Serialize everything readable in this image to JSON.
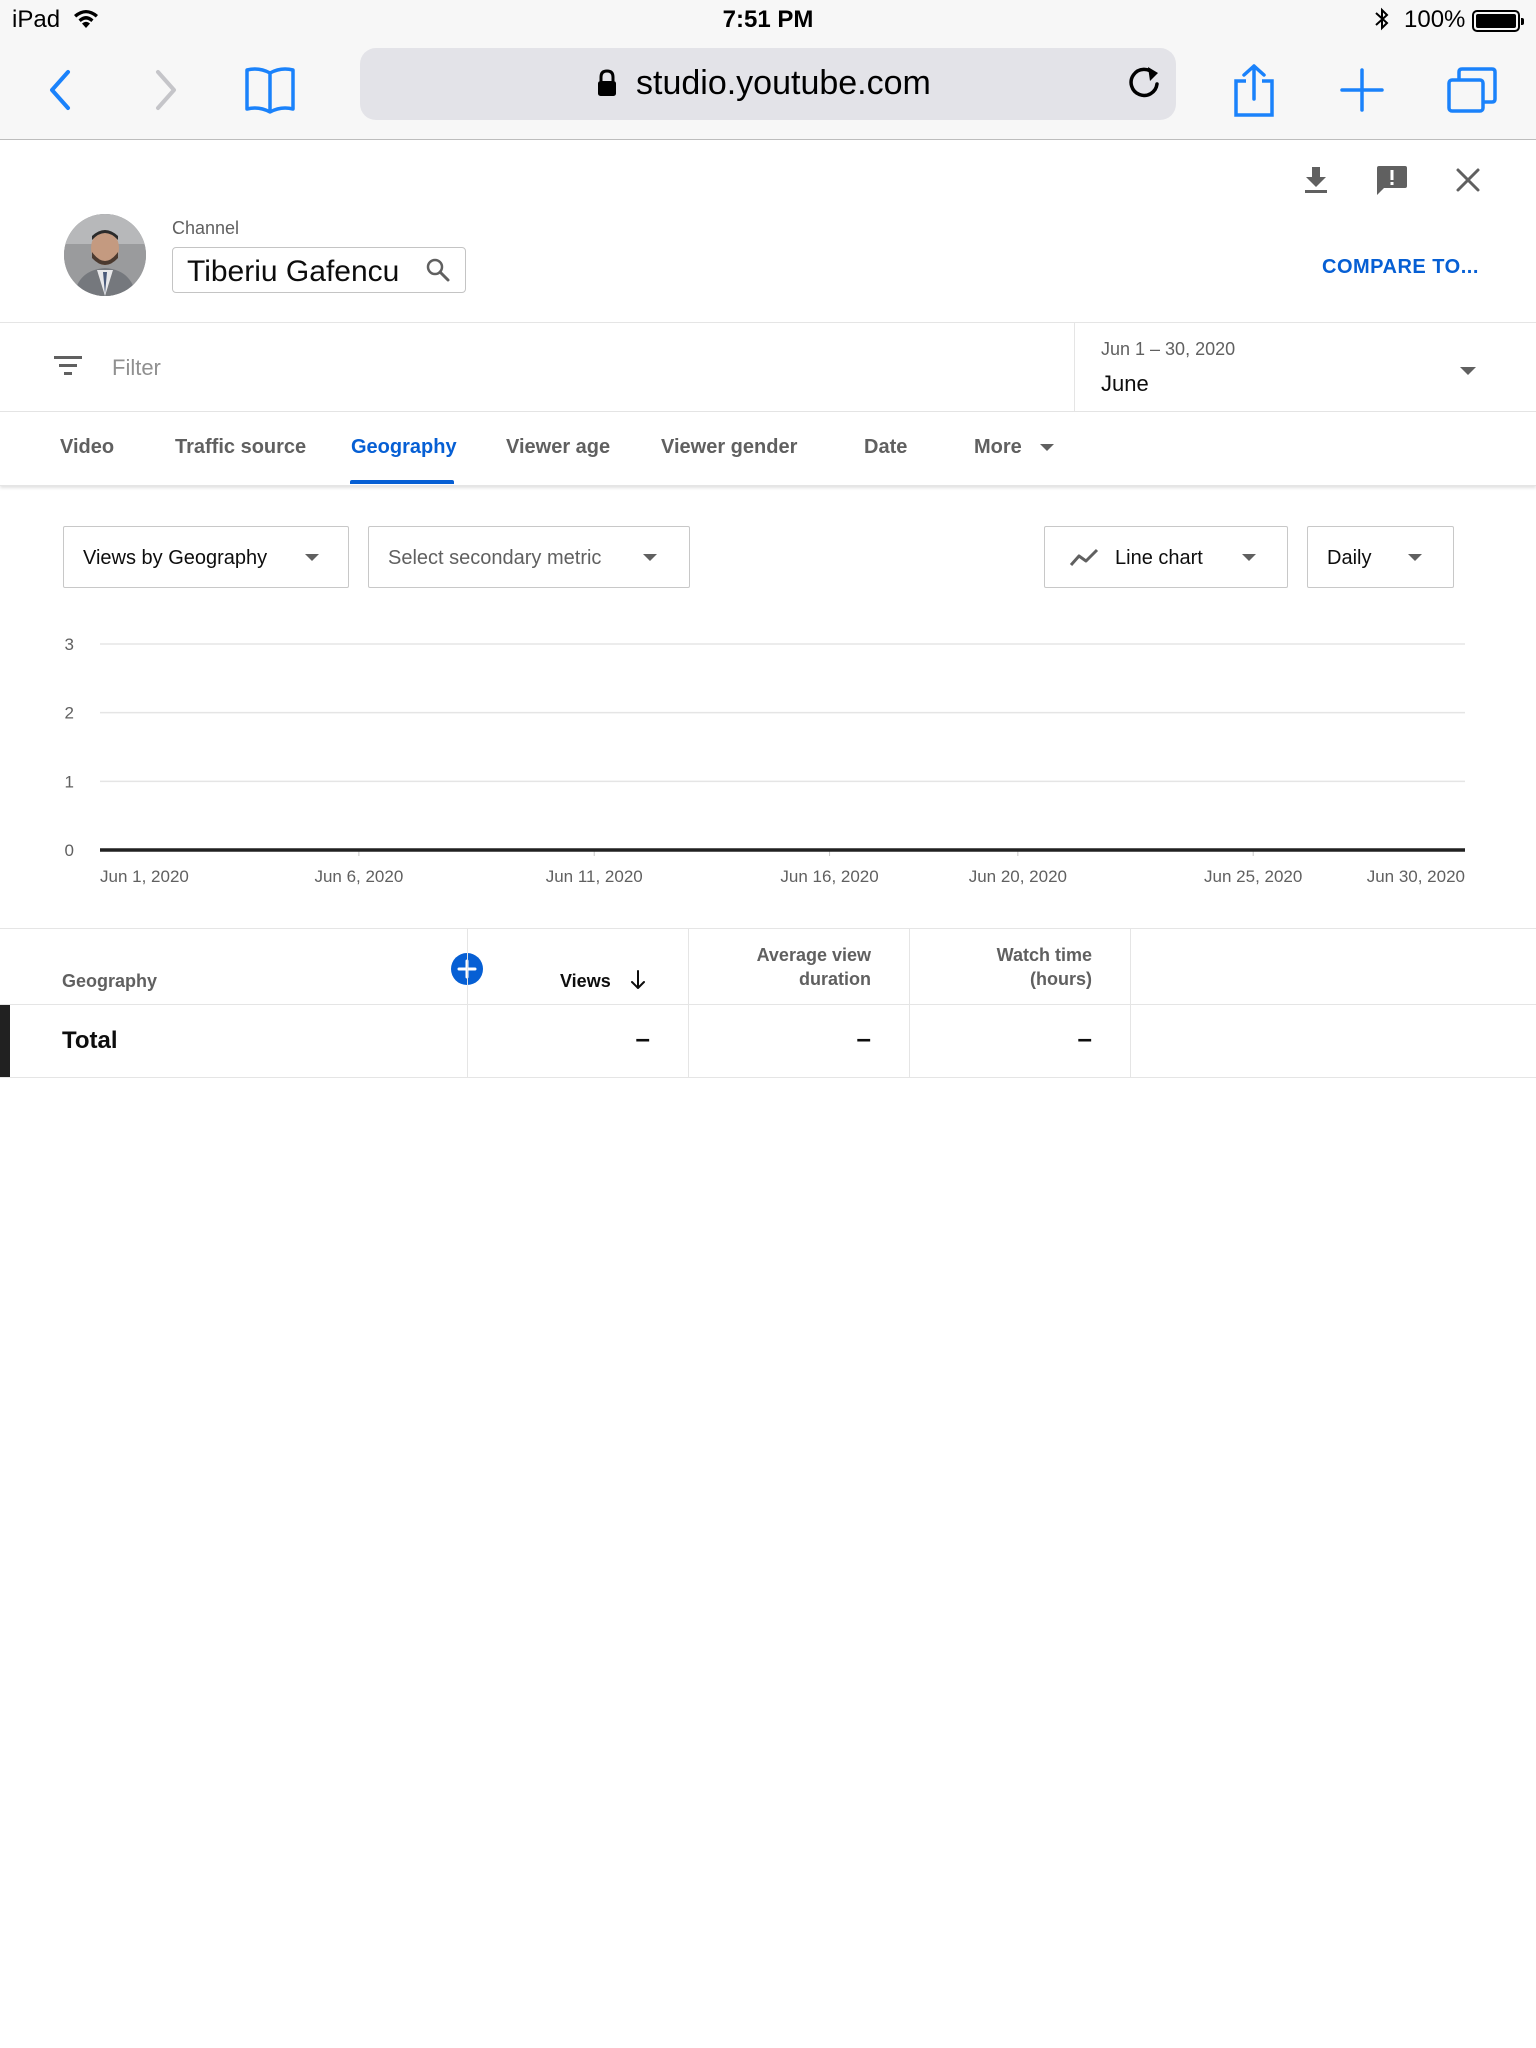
{
  "status_bar": {
    "device": "iPad",
    "time": "7:51 PM",
    "battery": "100%"
  },
  "browser": {
    "url": "studio.youtube.com"
  },
  "header": {
    "channel_caption": "Channel",
    "channel_name": "Tiberiu Gafencu",
    "compare_label": "COMPARE TO..."
  },
  "filter": {
    "placeholder": "Filter",
    "date_range": "Jun 1 – 30, 2020",
    "date_label": "June"
  },
  "tabs": [
    {
      "label": "Video"
    },
    {
      "label": "Traffic source"
    },
    {
      "label": "Geography",
      "active": true
    },
    {
      "label": "Viewer age"
    },
    {
      "label": "Viewer gender"
    },
    {
      "label": "Date"
    },
    {
      "label": "More"
    }
  ],
  "selectors": {
    "primary_metric": "Views by Geography",
    "secondary_metric": "Select secondary metric",
    "chart_type": "Line chart",
    "interval": "Daily"
  },
  "chart_data": {
    "type": "line",
    "y_ticks": [
      "3",
      "2",
      "1",
      "0"
    ],
    "ylim": [
      0,
      3
    ],
    "x_tick_labels": [
      "Jun 1, 2020",
      "Jun 6, 2020",
      "Jun 11, 2020",
      "Jun 16, 2020",
      "Jun 20, 2020",
      "Jun 25, 2020",
      "Jun 30, 2020"
    ],
    "x": [
      "2020-06-01",
      "2020-06-30"
    ],
    "series": [
      {
        "values": [
          0,
          0
        ],
        "color": "#212121"
      }
    ],
    "grid": true
  },
  "table": {
    "headers": {
      "geography": "Geography",
      "views": "Views",
      "avg_view_duration_1": "Average view",
      "avg_view_duration_2": "duration",
      "watch_time_1": "Watch time",
      "watch_time_2": "(hours)"
    },
    "total_row": {
      "label": "Total",
      "views": "–",
      "avg_view_duration": "–",
      "watch_time": "–"
    }
  },
  "colors": {
    "accent": "#065fd4",
    "ios_blue": "#1a82fb"
  }
}
